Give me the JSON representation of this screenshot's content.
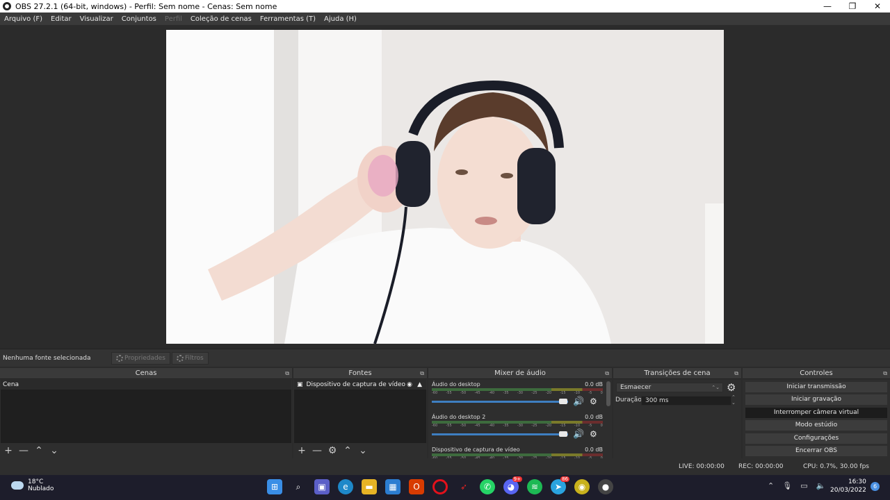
{
  "window": {
    "title": "OBS 27.2.1 (64-bit, windows) - Perfil: Sem nome - Cenas: Sem nome",
    "minimize_icon": "—",
    "maximize_icon": "❐",
    "close_icon": "✕"
  },
  "menu": {
    "items": [
      "Arquivo (F)",
      "Editar",
      "Visualizar",
      "Conjuntos",
      "Perfil",
      "Coleção de cenas",
      "Ferramentas (T)",
      "Ajuda (H)"
    ]
  },
  "source_toolbar": {
    "no_selection": "Nenhuma fonte selecionada",
    "properties": "Propriedades",
    "filters": "Filtros"
  },
  "scenes": {
    "title": "Cenas",
    "items": [
      "Cena"
    ]
  },
  "sources": {
    "title": "Fontes",
    "items": [
      "Dispositivo de captura de vídeo"
    ]
  },
  "mixer": {
    "title": "Mixer de áudio",
    "ticks": [
      "-60",
      "-55",
      "-50",
      "-45",
      "-40",
      "-35",
      "-30",
      "-25",
      "-20",
      "-15",
      "-10",
      "-5",
      "0"
    ],
    "channels": [
      {
        "name": "Áudio do desktop",
        "db": "0.0 dB",
        "volume": 1.0
      },
      {
        "name": "Áudio do desktop 2",
        "db": "0.0 dB",
        "volume": 1.0
      },
      {
        "name": "Dispositivo de captura de vídeo",
        "db": "0.0 dB",
        "volume": 1.0
      }
    ]
  },
  "transitions": {
    "title": "Transições de cena",
    "selected": "Esmaecer",
    "duration_label": "Duração",
    "duration_value": "300 ms"
  },
  "controls": {
    "title": "Controles",
    "buttons": [
      "Iniciar transmissão",
      "Iniciar gravação",
      "Interromper câmera virtual",
      "Modo estúdio",
      "Configurações",
      "Encerrar OBS"
    ]
  },
  "status": {
    "live": "LIVE: 00:00:00",
    "rec": "REC: 00:00:00",
    "cpu": "CPU: 0.7%, 30.00 fps"
  },
  "taskbar": {
    "temperature": "18°C",
    "weather": "Nublado",
    "time": "16:30",
    "date": "20/03/2022",
    "notifications": "6",
    "discord_badge": "9+",
    "telegram_badge": "86",
    "apps": [
      "windows-start",
      "search",
      "chat",
      "edge",
      "file-explorer",
      "store",
      "office",
      "opera",
      "game",
      "whatsapp",
      "discord",
      "spotify",
      "telegram",
      "app",
      "obs"
    ]
  },
  "colors": {
    "background": "#2b2b2b",
    "accent": "#3e7fc1",
    "taskbar": "#1d1d2b"
  }
}
